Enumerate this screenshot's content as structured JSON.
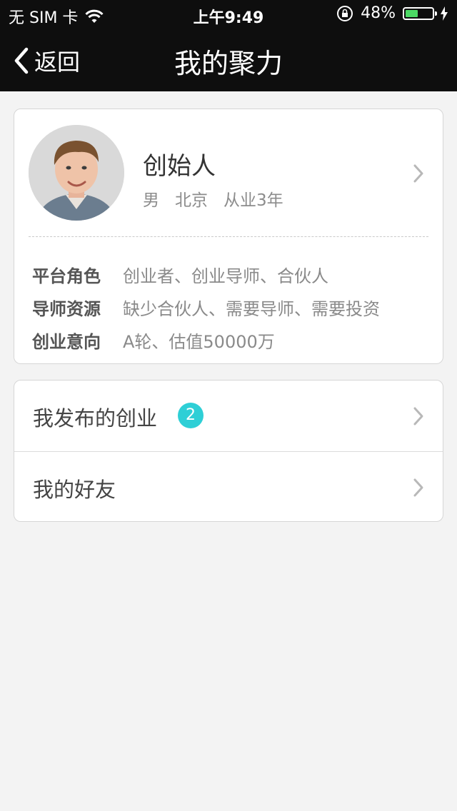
{
  "status_bar": {
    "carrier": "无 SIM 卡",
    "time": "上午9:49",
    "battery_percent_text": "48%",
    "battery_level": 0.48,
    "battery_color": "#4cd964",
    "icons": [
      "wifi-icon",
      "rotation-lock-icon",
      "battery-icon",
      "charging-bolt-icon"
    ]
  },
  "nav": {
    "back_label": "返回",
    "title": "我的聚力",
    "back_icon": "chevron-left-icon"
  },
  "profile": {
    "name": "创始人",
    "gender": "男",
    "city": "北京",
    "experience": "从业3年",
    "info": [
      {
        "label": "平台角色",
        "value": "创业者、创业导师、合伙人"
      },
      {
        "label": "导师资源",
        "value": "缺少合伙人、需要导师、需要投资"
      },
      {
        "label": "创业意向",
        "value": "A轮、估值50000万"
      }
    ]
  },
  "menu": {
    "items": [
      {
        "label": "我发布的创业",
        "badge": "2"
      },
      {
        "label": "我的好友"
      }
    ],
    "badge_color": "#2ecfd6"
  }
}
